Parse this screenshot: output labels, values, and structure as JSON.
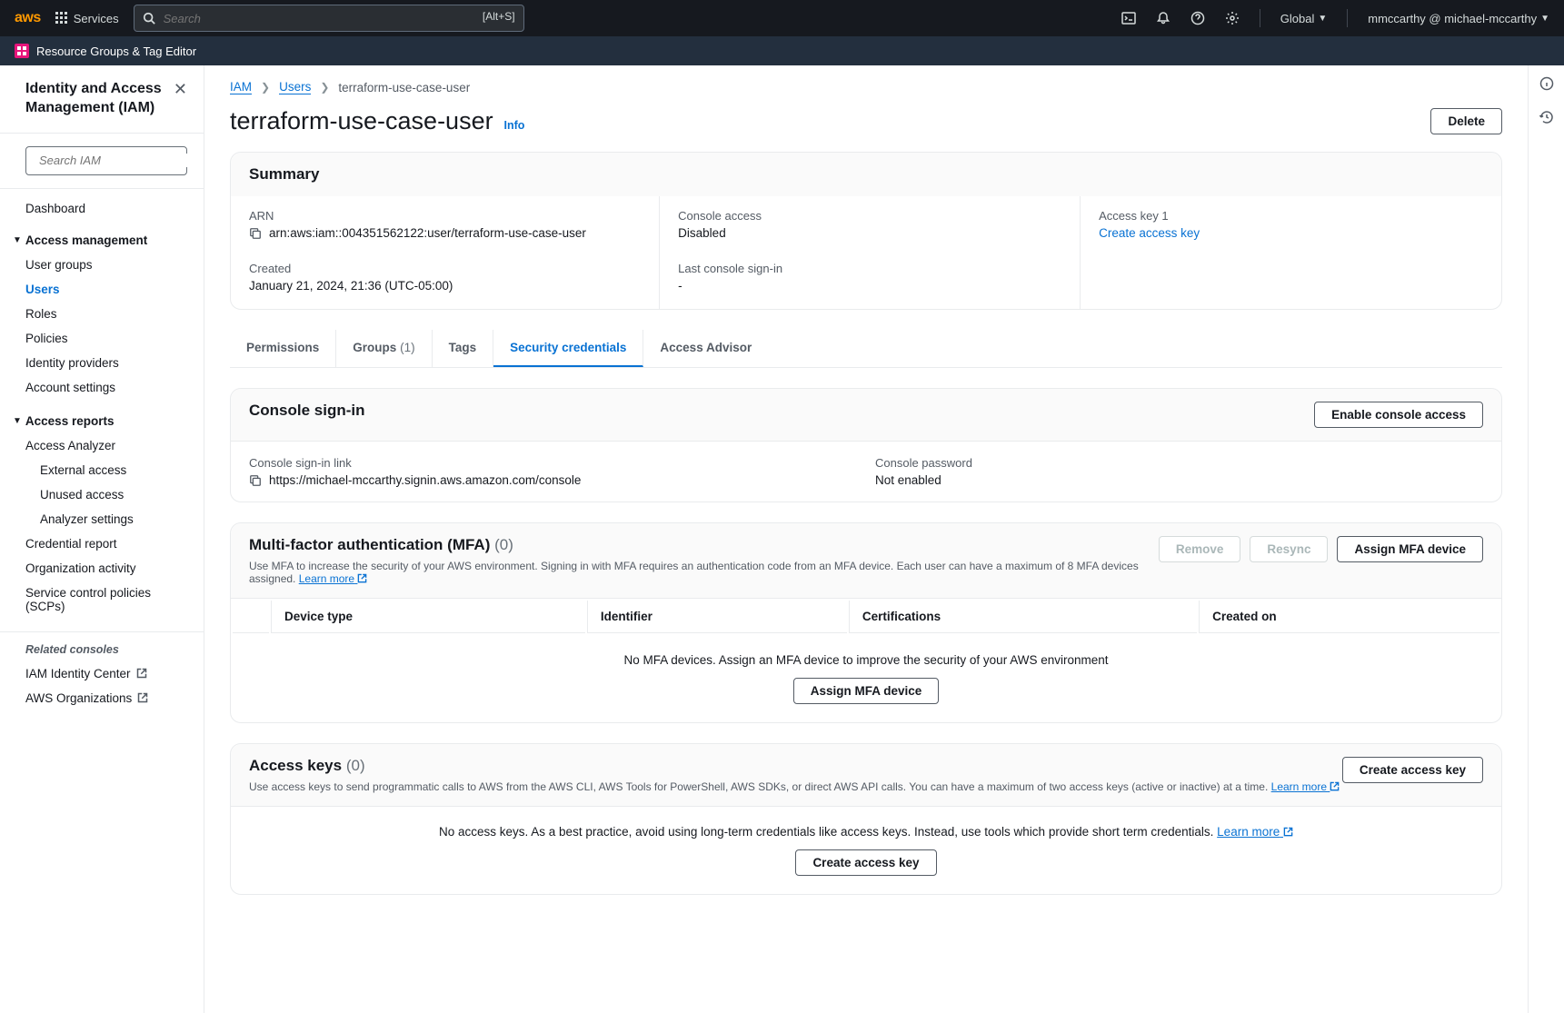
{
  "topnav": {
    "services_label": "Services",
    "search_placeholder": "Search",
    "search_shortcut": "[Alt+S]",
    "region": "Global",
    "account": "mmccarthy @ michael-mccarthy"
  },
  "secondbar": {
    "rg_label": "Resource Groups & Tag Editor"
  },
  "sidebar": {
    "title": "Identity and Access Management (IAM)",
    "search_placeholder": "Search IAM",
    "dashboard": "Dashboard",
    "access_mgmt_title": "Access management",
    "access_mgmt": {
      "user_groups": "User groups",
      "users": "Users",
      "roles": "Roles",
      "policies": "Policies",
      "identity_providers": "Identity providers",
      "account_settings": "Account settings"
    },
    "access_reports_title": "Access reports",
    "access_reports": {
      "access_analyzer": "Access Analyzer",
      "external_access": "External access",
      "unused_access": "Unused access",
      "analyzer_settings": "Analyzer settings",
      "credential_report": "Credential report",
      "organization_activity": "Organization activity",
      "scp": "Service control policies (SCPs)"
    },
    "related_title": "Related consoles",
    "related": {
      "iam_identity_center": "IAM Identity Center",
      "aws_organizations": "AWS Organizations"
    }
  },
  "breadcrumbs": {
    "iam": "IAM",
    "users": "Users",
    "current": "terraform-use-case-user"
  },
  "page": {
    "title": "terraform-use-case-user",
    "info": "Info",
    "delete": "Delete"
  },
  "summary": {
    "title": "Summary",
    "arn_label": "ARN",
    "arn_value": "arn:aws:iam::004351562122:user/terraform-use-case-user",
    "console_access_label": "Console access",
    "console_access_value": "Disabled",
    "access_key1_label": "Access key 1",
    "access_key1_link": "Create access key",
    "created_label": "Created",
    "created_value": "January 21, 2024, 21:36 (UTC-05:00)",
    "last_signin_label": "Last console sign-in",
    "last_signin_value": "-"
  },
  "tabs": {
    "permissions": "Permissions",
    "groups": "Groups",
    "groups_count": "(1)",
    "tags": "Tags",
    "security_credentials": "Security credentials",
    "access_advisor": "Access Advisor"
  },
  "console_signin": {
    "title": "Console sign-in",
    "enable_btn": "Enable console access",
    "link_label": "Console sign-in link",
    "link_value": "https://michael-mccarthy.signin.aws.amazon.com/console",
    "password_label": "Console password",
    "password_value": "Not enabled"
  },
  "mfa": {
    "title": "Multi-factor authentication (MFA)",
    "count": "(0)",
    "remove_btn": "Remove",
    "resync_btn": "Resync",
    "assign_btn": "Assign MFA device",
    "desc": "Use MFA to increase the security of your AWS environment. Signing in with MFA requires an authentication code from an MFA device. Each user can have a maximum of 8 MFA devices assigned.",
    "learn_more": "Learn more",
    "cols": {
      "device_type": "Device type",
      "identifier": "Identifier",
      "certifications": "Certifications",
      "created_on": "Created on"
    },
    "empty": "No MFA devices. Assign an MFA device to improve the security of your AWS environment",
    "empty_action": "Assign MFA device"
  },
  "access_keys": {
    "title": "Access keys",
    "count": "(0)",
    "create_btn": "Create access key",
    "desc": "Use access keys to send programmatic calls to AWS from the AWS CLI, AWS Tools for PowerShell, AWS SDKs, or direct AWS API calls. You can have a maximum of two access keys (active or inactive) at a time.",
    "learn_more": "Learn more",
    "empty": "No access keys. As a best practice, avoid using long-term credentials like access keys. Instead, use tools which provide short term credentials.",
    "empty_learn_more": "Learn more",
    "empty_action": "Create access key"
  }
}
